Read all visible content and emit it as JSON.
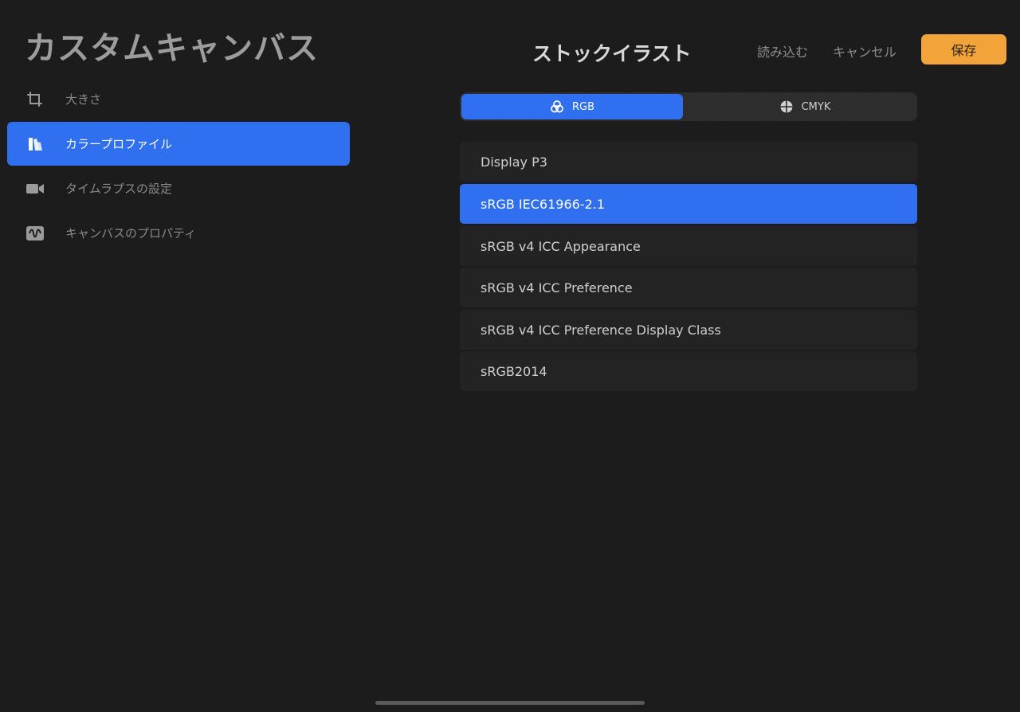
{
  "sidebar": {
    "title": "カスタムキャンバス",
    "items": [
      {
        "label": "大きさ",
        "icon": "crop-icon"
      },
      {
        "label": "カラープロファイル",
        "icon": "color-fan-icon"
      },
      {
        "label": "タイムラプスの設定",
        "icon": "video-camera-icon"
      },
      {
        "label": "キャンバスのプロパティ",
        "icon": "waveform-icon"
      }
    ]
  },
  "header": {
    "title": "ストックイラスト",
    "import_label": "読み込む",
    "cancel_label": "キャンセル",
    "save_label": "保存"
  },
  "segments": {
    "rgb": "RGB",
    "cmyk": "CMYK"
  },
  "profiles": [
    "Display P3",
    "sRGB IEC61966-2.1",
    "sRGB v4 ICC Appearance",
    "sRGB v4 ICC Preference",
    "sRGB v4 ICC Preference Display Class",
    "sRGB2014"
  ],
  "colors": {
    "accent": "#2f6ff0",
    "save_button": "#f2a43a",
    "background": "#1c1c1c"
  }
}
